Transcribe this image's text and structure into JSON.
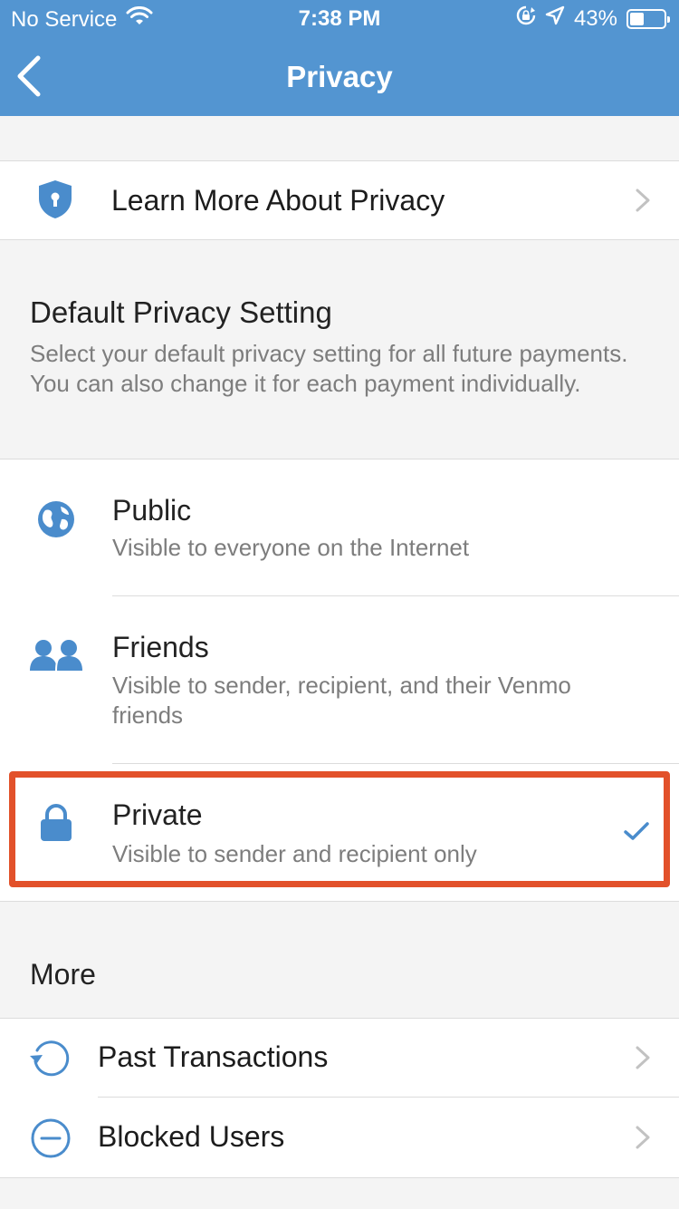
{
  "status_bar": {
    "carrier": "No Service",
    "time": "7:38 PM",
    "battery": "43%",
    "battery_level": 0.43
  },
  "nav": {
    "title": "Privacy"
  },
  "learn_more": {
    "label": "Learn More About Privacy"
  },
  "default_setting": {
    "title": "Default Privacy Setting",
    "description": "Select your default privacy setting for all future payments. You can also change it for each payment individually.",
    "options": [
      {
        "title": "Public",
        "description": "Visible to everyone on the Internet",
        "selected": false
      },
      {
        "title": "Friends",
        "description": "Visible to sender, recipient, and their Venmo friends",
        "selected": false
      },
      {
        "title": "Private",
        "description": "Visible to sender and recipient only",
        "selected": true
      }
    ]
  },
  "more": {
    "title": "More",
    "items": [
      {
        "label": "Past Transactions"
      },
      {
        "label": "Blocked Users"
      }
    ]
  },
  "colors": {
    "brand_blue": "#5395d1",
    "icon_blue": "#4a8ccc",
    "highlight_red": "#e2512a"
  }
}
